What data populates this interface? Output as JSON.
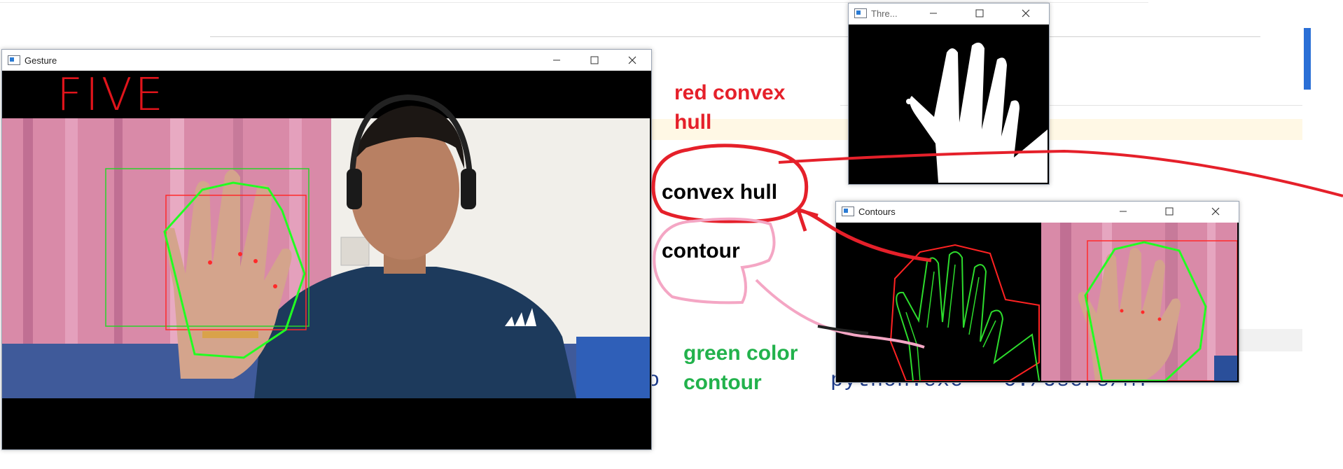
{
  "background": {
    "console_line_left": ":",
    "console_mid": "o",
    "console_cmd": "python.exe   C:/Users/MY"
  },
  "gesture_window": {
    "title": "Gesture",
    "label": "FIVE",
    "label_color": "#e0141b"
  },
  "threshold_window": {
    "title": "Thre..."
  },
  "contours_window": {
    "title": "Contours"
  },
  "annotations": {
    "red_hull_label": "red convex hull",
    "convex_hull": "convex hull",
    "contour": "contour",
    "green_contour_label": "green color contour",
    "red_color": "#e5202a",
    "green_color": "#22b24c",
    "pink_color": "#f4a6c4"
  },
  "icons": {
    "minimize": "minimize-icon",
    "maximize": "maximize-icon",
    "close": "close-icon"
  }
}
